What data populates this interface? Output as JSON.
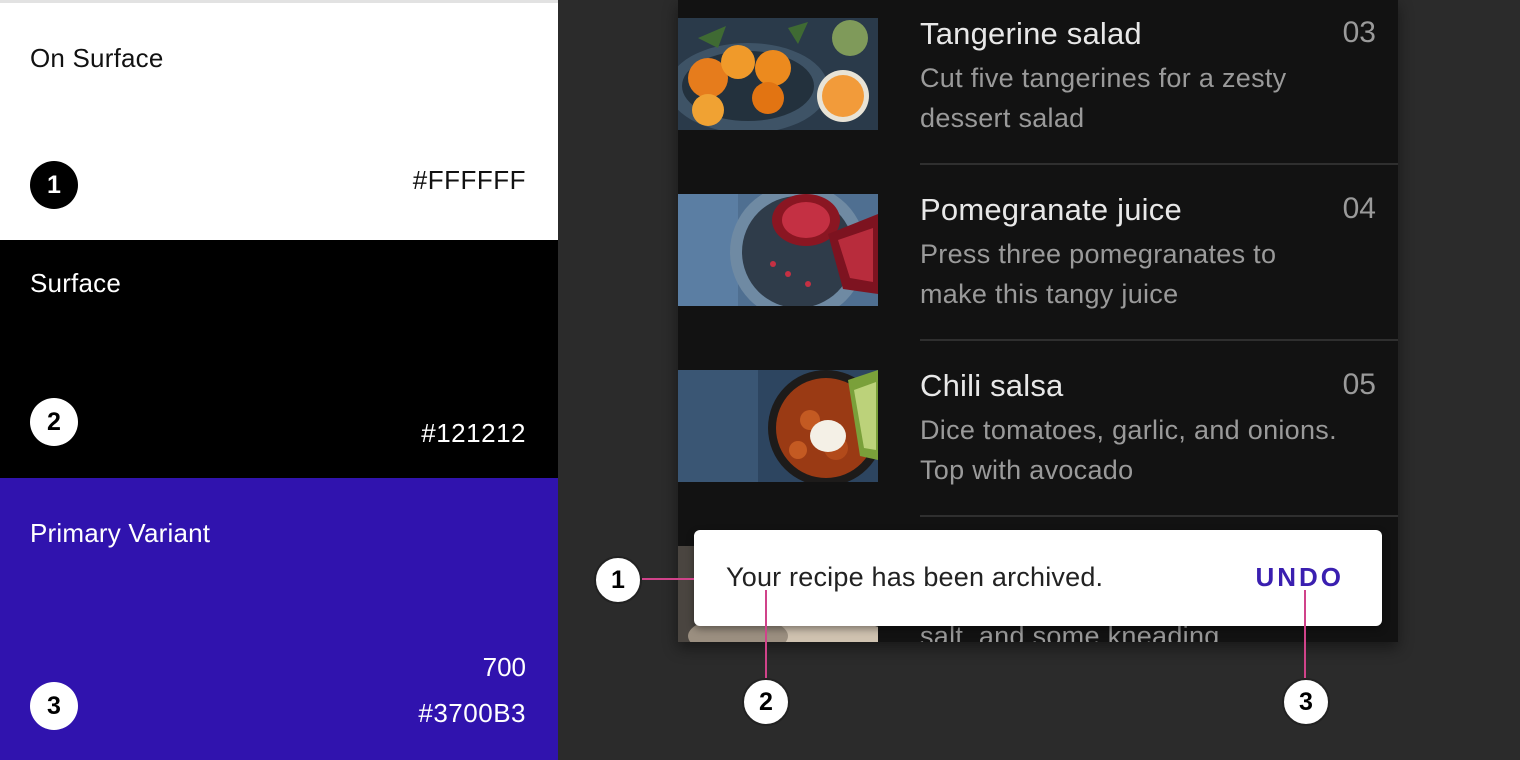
{
  "palette": {
    "swatches": [
      {
        "name": "On Surface",
        "number": "1",
        "hex": "#FFFFFF",
        "tone": ""
      },
      {
        "name": "Surface",
        "number": "2",
        "hex": "#121212",
        "tone": ""
      },
      {
        "name": "Primary Variant",
        "number": "3",
        "hex": "#3700B3",
        "tone": "700"
      }
    ]
  },
  "list": {
    "rows": [
      {
        "title": "Tangerine salad",
        "desc": "Cut five tangerines for a zesty dessert salad",
        "index": "03"
      },
      {
        "title": "Pomegranate juice",
        "desc": "Press three pomegranates to make this tangy juice",
        "index": "04"
      },
      {
        "title": "Chili salsa",
        "desc": "Dice tomatoes, garlic, and onions. Top with avocado",
        "index": "05"
      },
      {
        "desc": "salt, and some kneading"
      }
    ]
  },
  "snackbar": {
    "message": "Your recipe has been archived.",
    "action": "UNDO"
  },
  "annotations": {
    "m1": "1",
    "m2": "2",
    "m3": "3"
  },
  "colors": {
    "surface_dark": "#121212",
    "primary_variant": "#3700B3",
    "annotation_line": "#d0438a",
    "background": "#2b2b2b"
  }
}
